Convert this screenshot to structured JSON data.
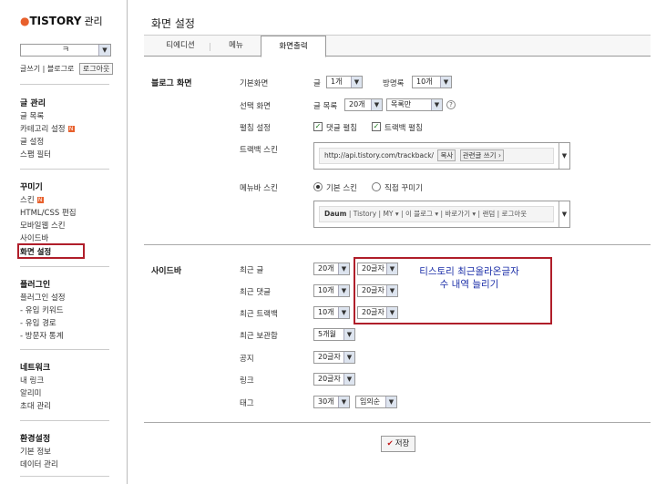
{
  "sidebar": {
    "logo": "TISTORY",
    "logo_sub": "관리",
    "blog_select": "ㅋ",
    "links": {
      "write": "글쓰기",
      "blog_home": "블로그로",
      "logout": "로그아웃"
    },
    "sections": [
      {
        "title": "글 관리",
        "items": [
          "글 목록",
          "카테고리 설정",
          "글 설정",
          "스팸 필터"
        ]
      },
      {
        "title": "꾸미기",
        "items": [
          "스킨",
          "HTML/CSS 편집",
          "모바일웹 스킨",
          "사이드바",
          "화면 설정"
        ]
      },
      {
        "title": "플러그인",
        "items": [
          "플러그인 설정",
          "- 유입 키워드",
          "- 유입 경로",
          "- 방문자 통계"
        ]
      },
      {
        "title": "네트워크",
        "items": [
          "내 링크",
          "알리미",
          "초대 관리"
        ]
      },
      {
        "title": "환경설정",
        "items": [
          "기본 정보",
          "데이터 관리"
        ]
      }
    ],
    "badge": "N"
  },
  "main": {
    "title": "화면 설정",
    "tabs": [
      "티에디션",
      "메뉴",
      "화면출력"
    ],
    "blog_screen": {
      "label": "블로그 화면",
      "default_label": "기본화면",
      "post_label": "글",
      "post_value": "1개",
      "guestbook_label": "방명록",
      "guestbook_value": "10개",
      "select_label": "선택 화면",
      "list_label": "글 목록",
      "list_value": "20개",
      "list_mode": "목록만",
      "help": "?",
      "fold_label": "펼침 설정",
      "fold_comment": "댓글 펼침",
      "fold_trackback": "트랙백 펼침",
      "trackback_label": "트랙백 스킨",
      "trackback_url": "http://api.tistory.com/trackback/",
      "trackback_copy": "복사",
      "trackback_related": "관련글 쓰기 ›",
      "menubar_label": "메뉴바 스킨",
      "menubar_basic": "기본 스킨",
      "menubar_custom": "직접 꾸미기",
      "menubar_items": [
        "Daum",
        "Tistory",
        "MY ▾",
        "이 블로그 ▾",
        "바로가기 ▾",
        "랜덤",
        "로그아웃"
      ]
    },
    "sidebar_settings": {
      "label": "사이드바",
      "rows": [
        {
          "label": "최근 글",
          "count": "20개",
          "length": "20글자"
        },
        {
          "label": "최근 댓글",
          "count": "10개",
          "length": "20글자"
        },
        {
          "label": "최근 트랙백",
          "count": "10개",
          "length": "20글자"
        },
        {
          "label": "최근 보관함",
          "count": "5개월",
          "length": ""
        },
        {
          "label": "공지",
          "count": "20글자",
          "length": ""
        },
        {
          "label": "링크",
          "count": "20글자",
          "length": ""
        },
        {
          "label": "태그",
          "count": "30개",
          "length": "임의순"
        }
      ]
    },
    "annotation": [
      "티스토리 최근올라온글자",
      "수 내역 늘리기"
    ],
    "save": "저장"
  },
  "colors": {
    "accent": "#e8602c",
    "highlight": "#b01e2a",
    "annotation_text": "#1c2fa8"
  }
}
